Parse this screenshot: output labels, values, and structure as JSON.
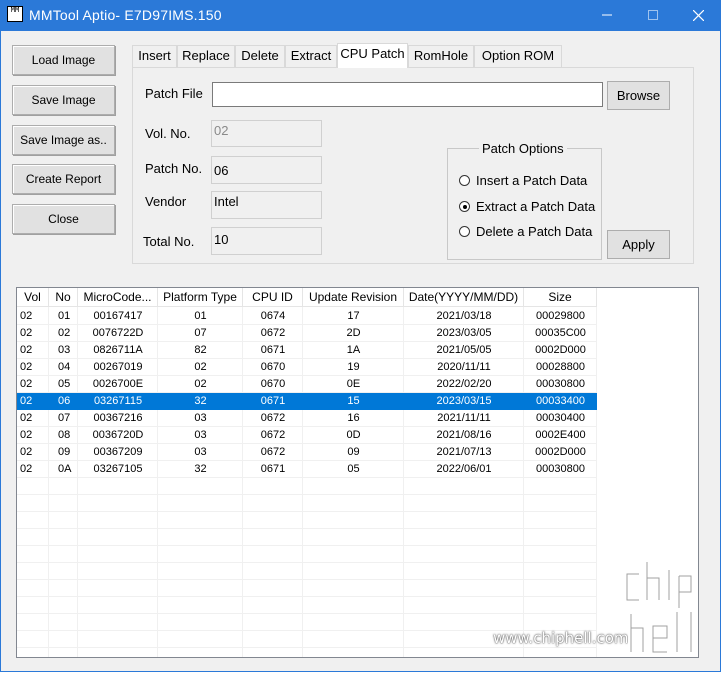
{
  "window": {
    "title": "MMTool Aptio- E7D97IMS.150",
    "icon_text": "MM",
    "minimize_icon": "minimize-icon",
    "maximize_icon": "maximize-icon",
    "close_icon": "close-icon",
    "accent_color": "#2b79d8"
  },
  "left_buttons": {
    "load": "Load Image",
    "save": "Save Image",
    "save_as": "Save Image as..",
    "report": "Create Report",
    "close": "Close"
  },
  "tabs": [
    "Insert",
    "Replace",
    "Delete",
    "Extract",
    "CPU Patch",
    "RomHole",
    "Option ROM"
  ],
  "active_tab": "CPU Patch",
  "patch": {
    "patch_file_label": "Patch File",
    "patch_file_value": "",
    "browse": "Browse",
    "vol_label": "Vol. No.",
    "vol_value": "02",
    "patch_no_label": "Patch No.",
    "patch_no_value": "06",
    "vendor_label": "Vendor",
    "vendor_value": "Intel",
    "total_label": "Total No.",
    "total_value": "10",
    "options_title": "Patch Options",
    "options": [
      "Insert a Patch Data",
      "Extract a Patch Data",
      "Delete a Patch Data"
    ],
    "selected_option": "Extract a Patch Data",
    "apply": "Apply"
  },
  "list": {
    "columns": [
      "Vol",
      "No",
      "MicroCode...",
      "Platform Type",
      "CPU ID",
      "Update Revision",
      "Date(YYYY/MM/DD)",
      "Size"
    ],
    "rows": [
      [
        "02",
        "01",
        "00167417",
        "01",
        "0674",
        "17",
        "2021/03/18",
        "00029800"
      ],
      [
        "02",
        "02",
        "0076722D",
        "07",
        "0672",
        "2D",
        "2023/03/05",
        "00035C00"
      ],
      [
        "02",
        "03",
        "0826711A",
        "82",
        "0671",
        "1A",
        "2021/05/05",
        "0002D000"
      ],
      [
        "02",
        "04",
        "00267019",
        "02",
        "0670",
        "19",
        "2020/11/11",
        "00028800"
      ],
      [
        "02",
        "05",
        "0026700E",
        "02",
        "0670",
        "0E",
        "2022/02/20",
        "00030800"
      ],
      [
        "02",
        "06",
        "03267115",
        "32",
        "0671",
        "15",
        "2023/03/15",
        "00033400"
      ],
      [
        "02",
        "07",
        "00367216",
        "03",
        "0672",
        "16",
        "2021/11/11",
        "00030400"
      ],
      [
        "02",
        "08",
        "0036720D",
        "03",
        "0672",
        "0D",
        "2021/08/16",
        "0002E400"
      ],
      [
        "02",
        "09",
        "00367209",
        "03",
        "0672",
        "09",
        "2021/07/13",
        "0002D000"
      ],
      [
        "02",
        "0A",
        "03267105",
        "32",
        "0671",
        "05",
        "2022/06/01",
        "00030800"
      ]
    ],
    "selected_row": 5,
    "selection_color": "#0078d7"
  },
  "watermark": {
    "text": "www.chiphell.com",
    "logo_text": "chip hell"
  }
}
